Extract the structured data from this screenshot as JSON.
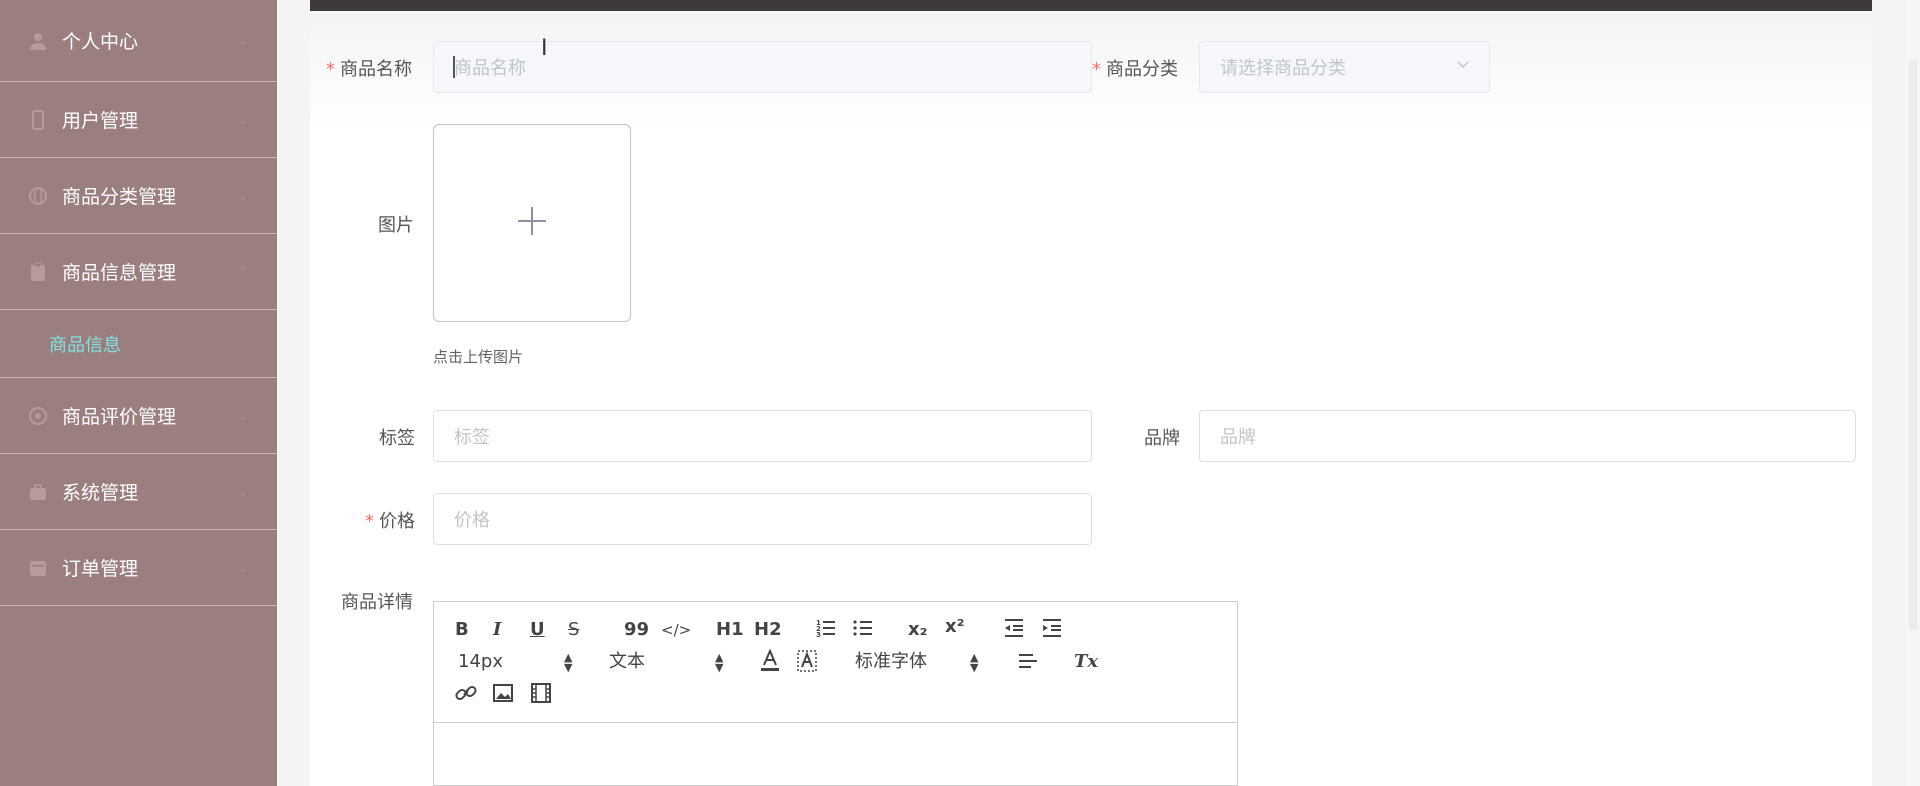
{
  "sidebar": {
    "items": [
      {
        "label": "个人中心",
        "icon": "user-icon"
      },
      {
        "label": "用户管理",
        "icon": "phone-icon"
      },
      {
        "label": "商品分类管理",
        "icon": "globe-icon"
      },
      {
        "label": "商品信息管理",
        "icon": "clipboard-icon",
        "expanded": true
      },
      {
        "label": "商品评价管理",
        "icon": "target-icon"
      },
      {
        "label": "系统管理",
        "icon": "briefcase-icon"
      },
      {
        "label": "订单管理",
        "icon": "calendar-icon"
      }
    ],
    "submenu_label": "商品信息"
  },
  "form": {
    "name": {
      "label": "商品名称",
      "placeholder": "商品名称"
    },
    "category": {
      "label": "商品分类",
      "placeholder": "请选择商品分类"
    },
    "image": {
      "label": "图片",
      "hint": "点击上传图片"
    },
    "tag": {
      "label": "标签",
      "placeholder": "标签"
    },
    "brand": {
      "label": "品牌",
      "placeholder": "品牌"
    },
    "price": {
      "label": "价格",
      "placeholder": "价格"
    },
    "detail": {
      "label": "商品详情"
    },
    "required_mark": "*"
  },
  "editor": {
    "font_size": "14px",
    "block_format": "文本",
    "font_family": "标准字体",
    "buttons": {
      "bold": "B",
      "italic": "I",
      "underline": "U",
      "strike": "S",
      "quote": "99",
      "code": "</>",
      "h1": "H1",
      "h2": "H2",
      "sub": "x₂",
      "sup": "x²",
      "clean": "Tx"
    }
  },
  "colors": {
    "sidebar_bg": "#9b7f7f",
    "submenu_active": "#7fe3e3",
    "required": "#f56c6c",
    "topbar": "#3e3a39"
  }
}
